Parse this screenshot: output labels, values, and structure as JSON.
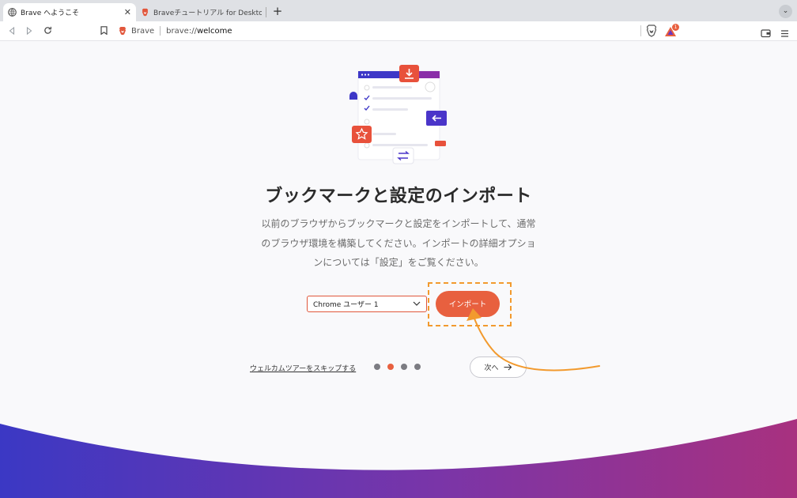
{
  "browser": {
    "tabs": [
      {
        "label": "Brave へようこそ",
        "active": true,
        "close": "✕"
      },
      {
        "label": "Braveチュートリアル for Desktop | Br",
        "active": false
      }
    ],
    "new_tab": "+",
    "tab_menu": "⌄",
    "address": {
      "brand": "Brave",
      "url_prefix": "brave://",
      "url_host": "welcome"
    },
    "rewards_badge": "1"
  },
  "welcome": {
    "title": "ブックマークと設定のインポート",
    "description_lines": [
      "以前のブラウザからブックマークと設定をインポートして、通常",
      "のブラウザ環境を構築してください。インポートの詳細オプショ",
      "ンについては「設定」をご覧ください。"
    ],
    "profile_select": "Chrome ユーザー 1",
    "import_button": "インポート",
    "skip_link": "ウェルカムツアーをスキップする",
    "next_button": "次へ",
    "step_dots": {
      "total": 4,
      "active_index": 1
    }
  },
  "colors": {
    "accent": "#e8603f",
    "annotation": "#f29a2e",
    "wave_start": "#3b38c4",
    "wave_end": "#a8317f"
  }
}
